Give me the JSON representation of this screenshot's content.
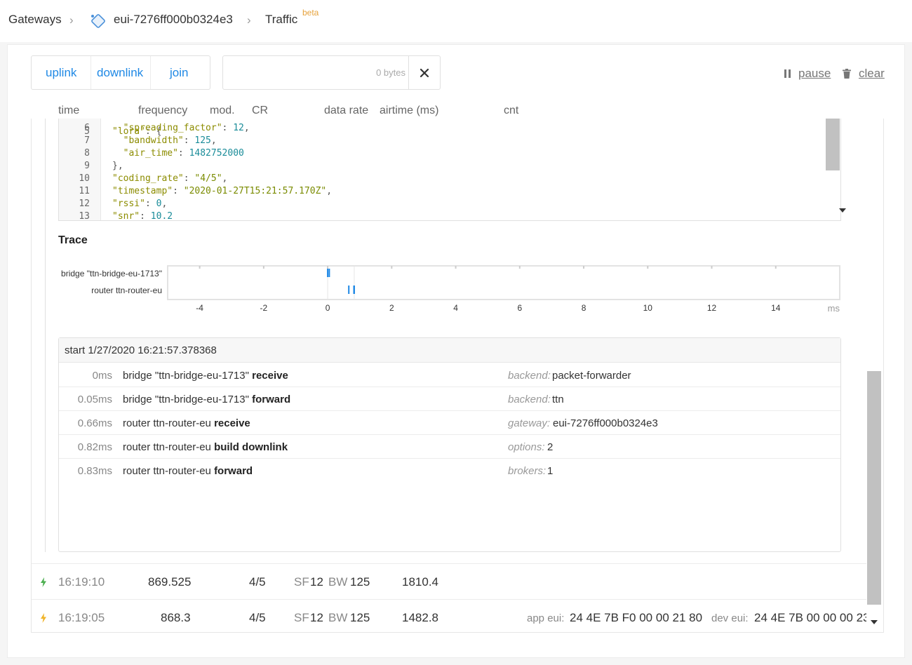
{
  "breadcrumb": {
    "gateways": "Gateways",
    "gateway_id": "eui-7276ff000b0324e3",
    "traffic": "Traffic",
    "beta": "beta"
  },
  "tabs": [
    "uplink",
    "downlink",
    "join"
  ],
  "filter": {
    "placeholder": "0 bytes"
  },
  "controls": {
    "pause": "pause",
    "clear": "clear"
  },
  "columns": [
    "time",
    "frequency",
    "mod.",
    "CR",
    "data rate",
    "airtime (ms)",
    "cnt"
  ],
  "code_lines": [
    {
      "n": "6",
      "segments": [
        [
          "k",
          "  \"spreading_factor\""
        ],
        [
          "p",
          ": "
        ],
        [
          "n",
          "12"
        ],
        [
          "p",
          ","
        ]
      ]
    },
    {
      "n": "7",
      "segments": [
        [
          "k",
          "  \"bandwidth\""
        ],
        [
          "p",
          ": "
        ],
        [
          "n",
          "125"
        ],
        [
          "p",
          ","
        ]
      ]
    },
    {
      "n": "8",
      "segments": [
        [
          "k",
          "  \"air_time\""
        ],
        [
          "p",
          ": "
        ],
        [
          "n",
          "1482752000"
        ]
      ]
    },
    {
      "n": "9",
      "segments": [
        [
          "p",
          "},"
        ]
      ]
    },
    {
      "n": "10",
      "segments": [
        [
          "k",
          "\"coding_rate\""
        ],
        [
          "p",
          ": "
        ],
        [
          "s",
          "\"4/5\""
        ],
        [
          "p",
          ","
        ]
      ]
    },
    {
      "n": "11",
      "segments": [
        [
          "k",
          "\"timestamp\""
        ],
        [
          "p",
          ": "
        ],
        [
          "s",
          "\"2020-01-27T15:21:57.170Z\""
        ],
        [
          "p",
          ","
        ]
      ]
    },
    {
      "n": "12",
      "segments": [
        [
          "k",
          "\"rssi\""
        ],
        [
          "p",
          ": "
        ],
        [
          "n",
          "0"
        ],
        [
          "p",
          ","
        ]
      ]
    },
    {
      "n": "13",
      "segments": [
        [
          "k",
          "\"snr\""
        ],
        [
          "p",
          ": "
        ],
        [
          "n",
          "10.2"
        ]
      ]
    }
  ],
  "trace": {
    "title": "Trace",
    "lanes": [
      "bridge \"ttn-bridge-eu-1713\"",
      "router ttn-router-eu"
    ],
    "ticks": [
      "-4",
      "-2",
      "0",
      "2",
      "4",
      "6",
      "8",
      "10",
      "12",
      "14"
    ],
    "unit": "ms"
  },
  "timeline": {
    "start": "start 1/27/2020 16:21:57.378368",
    "events": [
      {
        "time": "0ms",
        "actor": "bridge \"ttn-bridge-eu-1713\"",
        "action": "receive",
        "key": "backend:",
        "value": "packet-forwarder"
      },
      {
        "time": "0.05ms",
        "actor": "bridge \"ttn-bridge-eu-1713\"",
        "action": "forward",
        "key": "backend:",
        "value": "ttn"
      },
      {
        "time": "0.66ms",
        "actor": "router ttn-router-eu",
        "action": "receive",
        "key": "gateway:",
        "value": "eui-7276ff000b0324e3"
      },
      {
        "time": "0.82ms",
        "actor": "router ttn-router-eu",
        "action": "build downlink",
        "key": "options:",
        "value": "2"
      },
      {
        "time": "0.83ms",
        "actor": "router ttn-router-eu",
        "action": "forward",
        "key": "brokers:",
        "value": "1"
      }
    ]
  },
  "rows": [
    {
      "time": "16:19:10",
      "frequency": "869.525",
      "cr": "4/5",
      "sf_label": "SF",
      "sf": "12",
      "bw_label": "BW",
      "bw": "125",
      "airtime": "1810.4",
      "icon_color": "#4caf50"
    },
    {
      "time": "16:19:05",
      "frequency": "868.3",
      "cr": "4/5",
      "sf_label": "SF",
      "sf": "12",
      "bw_label": "BW",
      "bw": "125",
      "airtime": "1482.8",
      "icon_color": "#f0b429",
      "app_eui_label": "app eui:",
      "app_eui": "24 4E 7B F0 00 00 21 80",
      "dev_eui_label": "dev eui:",
      "dev_eui": "24 4E 7B 00 00 00 23"
    }
  ],
  "colors": {
    "link": "#1e88e5",
    "beta": "#e6a23c",
    "trace_bar": "#1e88e5"
  }
}
